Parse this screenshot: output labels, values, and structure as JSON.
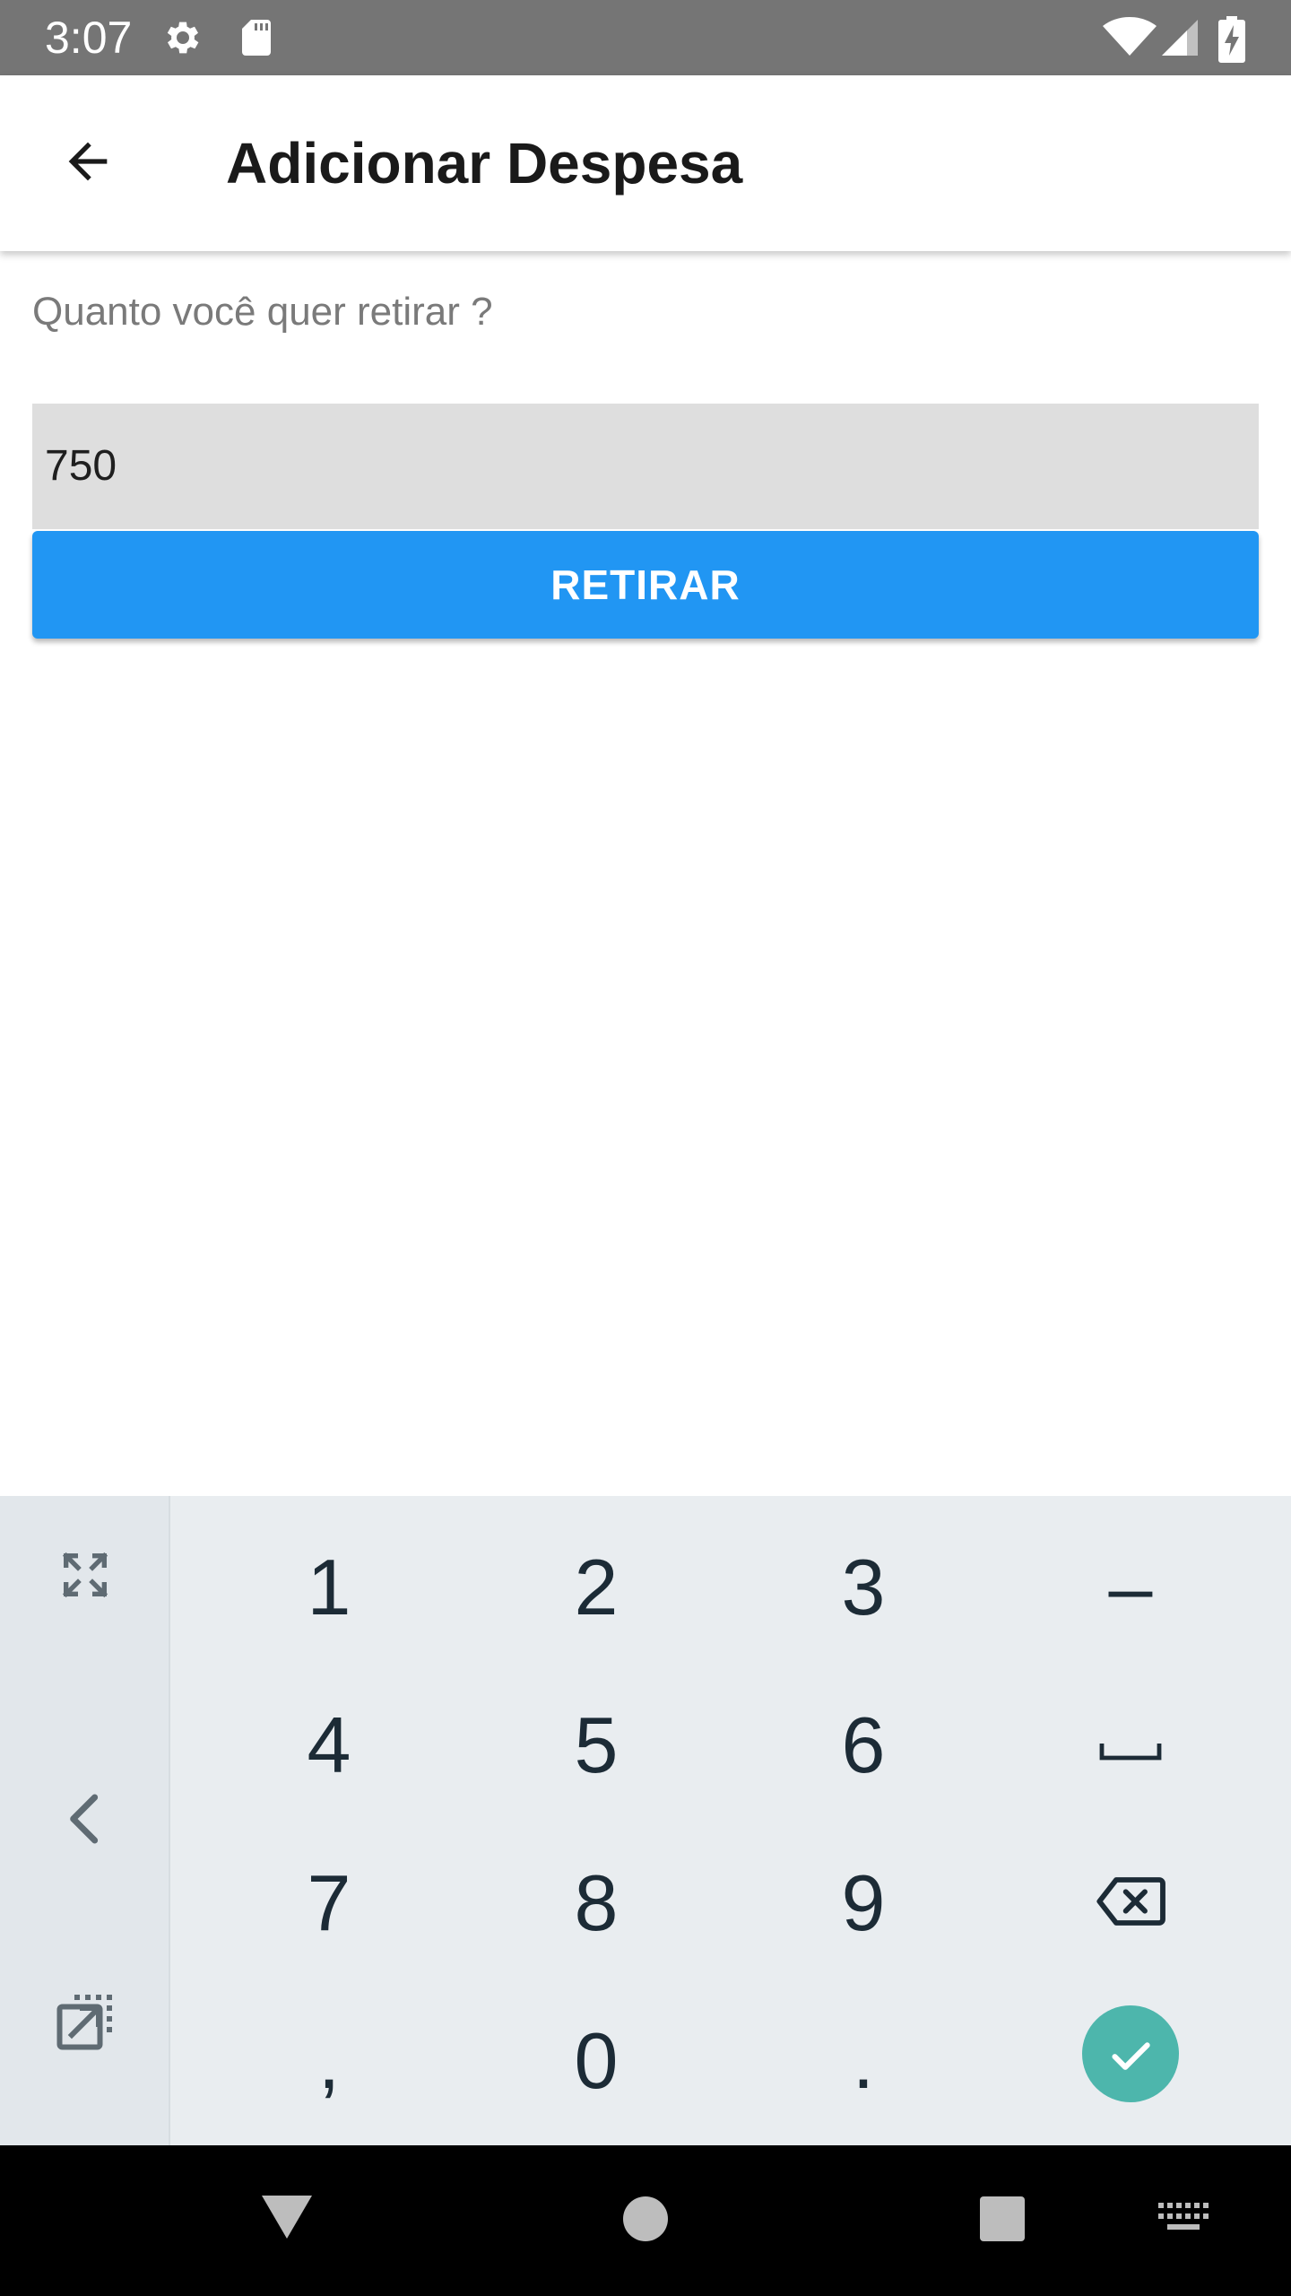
{
  "status_bar": {
    "time": "3:07",
    "left_icons": [
      "gear-icon",
      "sd-card-icon"
    ],
    "right_icons": [
      "wifi-icon",
      "signal-icon",
      "battery-charging-icon"
    ],
    "background": "#757575"
  },
  "app_bar": {
    "back_icon": "arrow-back-icon",
    "title": "Adicionar Despesa"
  },
  "form": {
    "prompt": "Quanto você quer retirar ?",
    "amount_value": "750",
    "submit_label": "RETIRAR",
    "accent_color": "#2196f3"
  },
  "keyboard": {
    "side_keys": [
      "fullscreen-icon",
      "chevron-left-icon",
      "external-edit-icon"
    ],
    "rows": [
      [
        "1",
        "2",
        "3",
        "–"
      ],
      [
        "4",
        "5",
        "6",
        "space"
      ],
      [
        "7",
        "8",
        "9",
        "backspace"
      ],
      [
        ",",
        "0",
        ".",
        "enter"
      ]
    ],
    "labels": {
      "r1c1": "1",
      "r1c2": "2",
      "r1c3": "3",
      "r1c4": "–",
      "r2c1": "4",
      "r2c2": "5",
      "r2c3": "6",
      "r3c1": "7",
      "r3c2": "8",
      "r3c3": "9",
      "r4c1": ",",
      "r4c2": "0",
      "r4c3": "."
    },
    "enter_color": "#4db6ac"
  },
  "nav_bar": {
    "buttons": [
      "back-triangle-icon",
      "home-circle-icon",
      "recents-square-icon",
      "keyboard-switch-icon"
    ]
  }
}
